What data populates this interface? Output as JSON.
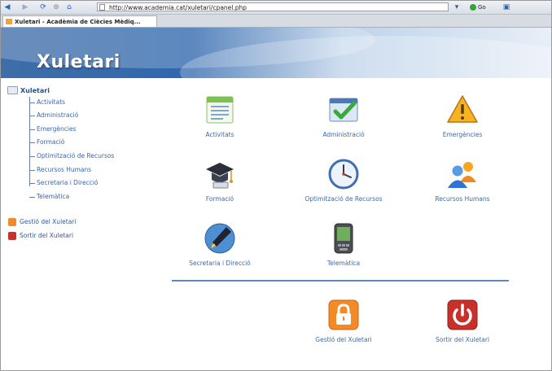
{
  "browser": {
    "url": "http://www.academia.cat/xuletari/cpanel.php",
    "go_label": "Go",
    "tab_title": "Xuletari - Acadèmia de Ciècies Mèdiq..."
  },
  "header": {
    "title": "Xuletari"
  },
  "sidebar": {
    "root": "Xuletari",
    "items": [
      {
        "label": "Activitats"
      },
      {
        "label": "Administració"
      },
      {
        "label": "Emergències"
      },
      {
        "label": "Formació"
      },
      {
        "label": "Optimització de Recursos"
      },
      {
        "label": "Recursos Humans"
      },
      {
        "label": "Secretaria i Direcció"
      },
      {
        "label": "Telemàtica"
      }
    ],
    "actions": [
      {
        "label": "Gestió del Xuletari",
        "color": "#f08a2a"
      },
      {
        "label": "Sortir del Xuletari",
        "color": "#c8322c"
      }
    ]
  },
  "grid": {
    "items": [
      {
        "label": "Activitats",
        "icon": "document-list-icon"
      },
      {
        "label": "Administració",
        "icon": "checkmark-window-icon"
      },
      {
        "label": "Emergències",
        "icon": "warning-triangle-icon"
      },
      {
        "label": "Formació",
        "icon": "graduation-hat-icon"
      },
      {
        "label": "Optimització de Recursos",
        "icon": "clock-icon"
      },
      {
        "label": "Recursos Humans",
        "icon": "users-group-icon"
      },
      {
        "label": "Secretaria i Direcció",
        "icon": "fountain-pen-icon"
      },
      {
        "label": "Telemàtica",
        "icon": "pda-device-icon"
      }
    ],
    "actions": [
      {
        "label": "Gestió del Xuletari",
        "icon": "padlock-icon"
      },
      {
        "label": "Sortir del Xuletari",
        "icon": "power-icon"
      }
    ]
  }
}
